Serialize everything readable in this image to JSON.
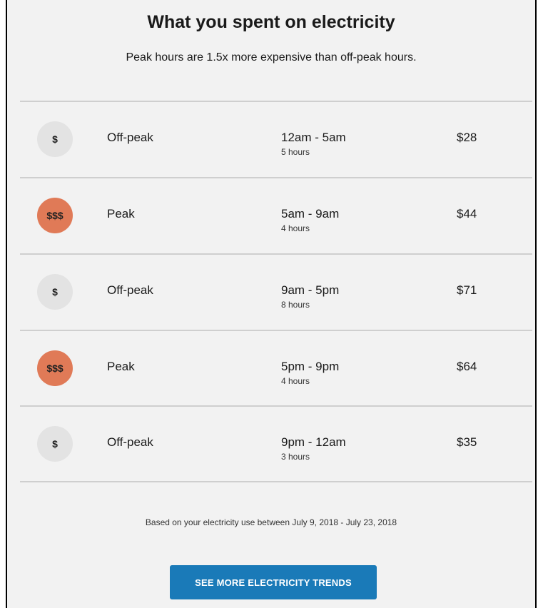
{
  "header": {
    "title": "What you spent on electricity",
    "subtitle": "Peak hours are 1.5x more expensive than off-peak hours."
  },
  "rows": [
    {
      "badge": "$",
      "type": "offpeak",
      "label": "Off-peak",
      "time": "12am - 5am",
      "hours": "5 hours",
      "amount": "$28"
    },
    {
      "badge": "$$$",
      "type": "peak",
      "label": "Peak",
      "time": "5am - 9am",
      "hours": "4 hours",
      "amount": "$44"
    },
    {
      "badge": "$",
      "type": "offpeak",
      "label": "Off-peak",
      "time": "9am - 5pm",
      "hours": "8 hours",
      "amount": "$71"
    },
    {
      "badge": "$$$",
      "type": "peak",
      "label": "Peak",
      "time": "5pm - 9pm",
      "hours": "4 hours",
      "amount": "$64"
    },
    {
      "badge": "$",
      "type": "offpeak",
      "label": "Off-peak",
      "time": "9pm - 12am",
      "hours": "3 hours",
      "amount": "$35"
    }
  ],
  "footer": {
    "note": "Based on your electricity use between July 9, 2018 - July 23, 2018",
    "button_label": "SEE MORE ELECTRICITY TRENDS"
  },
  "colors": {
    "panel_bg": "#f2f2f2",
    "peak_badge": "#e07a57",
    "offpeak_badge": "#e3e3e3",
    "button": "#1a7ab8",
    "divider": "#cfcfcf"
  }
}
